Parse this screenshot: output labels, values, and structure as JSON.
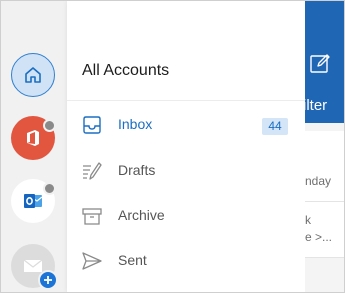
{
  "menu": {
    "title": "All Accounts",
    "items": [
      {
        "label": "Inbox",
        "count": "44",
        "icon": "inbox-icon"
      },
      {
        "label": "Drafts",
        "icon": "drafts-icon"
      },
      {
        "label": "Archive",
        "icon": "archive-icon"
      },
      {
        "label": "Sent",
        "icon": "sent-icon"
      }
    ]
  },
  "accounts": [
    {
      "icon": "home-icon",
      "selected": true
    },
    {
      "icon": "office-icon"
    },
    {
      "icon": "outlook-icon"
    },
    {
      "icon": "mail-add-icon"
    }
  ],
  "background": {
    "filter_label": "ilter",
    "row1_text": "nday",
    "row2_line1": "k",
    "row2_line2": "e >..."
  },
  "colors": {
    "accent": "#1b6ec2",
    "header_blue": "#1f66b5",
    "office_red": "#e2553f",
    "badge_bg": "#d3e5f7"
  }
}
